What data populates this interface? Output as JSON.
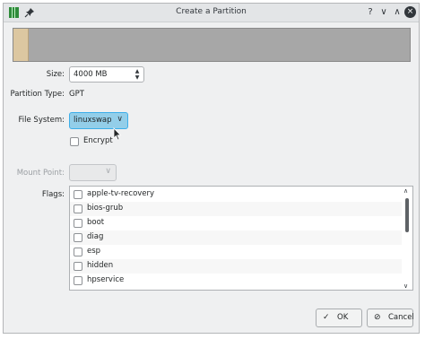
{
  "window": {
    "title": "Create a Partition",
    "help_label": "?",
    "minimize_label": "∨",
    "maximize_label": "∧",
    "close_label": "×"
  },
  "form": {
    "size_label": "Size:",
    "size_value": "4000 MB",
    "partition_type_label": "Partition Type:",
    "partition_type_value": "GPT",
    "file_system_label": "File System:",
    "file_system_value": "linuxswap",
    "encrypt_label": "Encrypt",
    "mount_point_label": "Mount Point:",
    "flags_label": "Flags:"
  },
  "flags": [
    "apple-tv-recovery",
    "bios-grub",
    "boot",
    "diag",
    "esp",
    "hidden",
    "hpservice"
  ],
  "buttons": {
    "ok_label": "OK",
    "cancel_label": "Cancel"
  }
}
